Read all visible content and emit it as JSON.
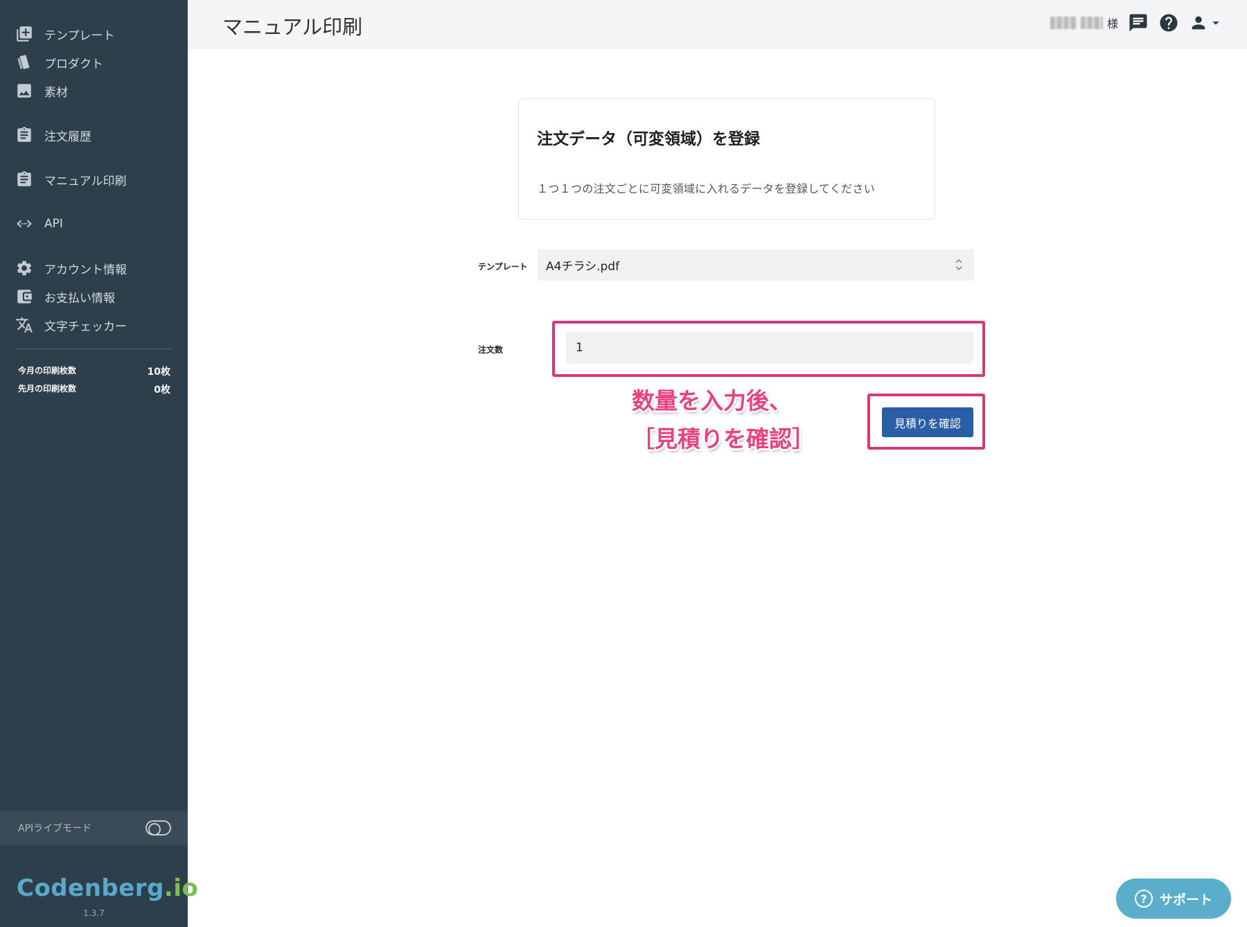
{
  "sidebar": {
    "nav": [
      {
        "label": "テンプレート",
        "icon": "add-box-icon"
      },
      {
        "label": "プロダクト",
        "icon": "cards-icon"
      },
      {
        "label": "素材",
        "icon": "image-icon"
      },
      {
        "label": "注文履歴",
        "icon": "clipboard-icon"
      },
      {
        "label": "マニュアル印刷",
        "icon": "clipboard-icon"
      },
      {
        "label": "API",
        "icon": "code-icon"
      },
      {
        "label": "アカウント情報",
        "icon": "gear-icon"
      },
      {
        "label": "お支払い情報",
        "icon": "wallet-icon"
      },
      {
        "label": "文字チェッカー",
        "icon": "translate-icon"
      }
    ],
    "stats": [
      {
        "label": "今月の印刷枚数",
        "value": "10枚"
      },
      {
        "label": "先月の印刷枚数",
        "value": "0枚"
      }
    ],
    "api_mode_label": "APIライブモード",
    "api_mode_on": false,
    "logo_main": "Codenberg",
    "logo_suffix": ".io",
    "version": "1.3.7"
  },
  "header": {
    "title": "マニュアル印刷",
    "user_suffix": "様"
  },
  "card": {
    "title": "注文データ（可変領域）を登録",
    "description": "１つ１つの注文ごとに可変領域に入れるデータを登録してください"
  },
  "form": {
    "template_label": "テンプレート",
    "template_value": "A4チラシ.pdf",
    "quantity_label": "注文数",
    "quantity_value": "1",
    "confirm_button": "見積りを確認"
  },
  "annotation": {
    "line1": "数量を入力後、",
    "line2": "［見積りを確認］",
    "color": "#e8427f",
    "box_color": "#d6397b"
  },
  "support_button": "サポート",
  "colors": {
    "sidebar_bg": "#2e3f4c",
    "primary_button": "#2a5fa8",
    "support_bg": "#5aaecb"
  }
}
